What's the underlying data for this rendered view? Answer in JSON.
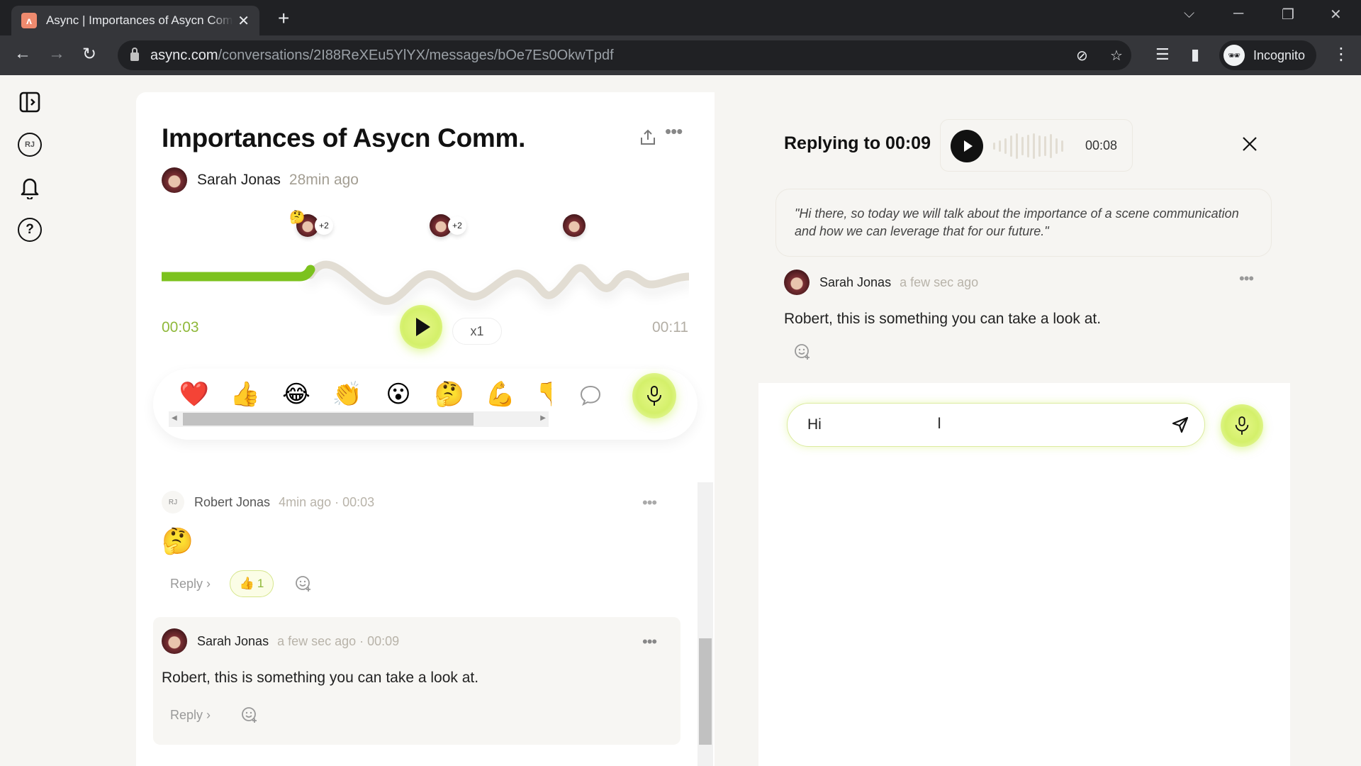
{
  "browser": {
    "tab_title": "Async | Importances of Asycn Comm.",
    "tab_close": "✕",
    "new_tab": "+",
    "url_host": "async.com",
    "url_path": "/conversations/2I88ReXEu5YlYX/messages/bOe7Es0OkwTpdf",
    "profile_label": "Incognito",
    "icons": [
      "back-icon",
      "forward-icon",
      "reload-icon",
      "lock-icon",
      "eye-off-icon",
      "star-icon",
      "media-icon",
      "sidepanel-icon",
      "incognito-icon",
      "menu-icon"
    ]
  },
  "rail": {
    "items": [
      {
        "name": "toggle-sidebar",
        "icon": "sidebar-expand-icon"
      },
      {
        "name": "profile",
        "label": "RJ"
      },
      {
        "name": "notifications",
        "icon": "bell-icon"
      },
      {
        "name": "help",
        "label": "?"
      }
    ]
  },
  "conversation": {
    "title": "Importances of Asycn Comm.",
    "author": "Sarah Jonas",
    "time_ago": "28min ago",
    "markers": [
      {
        "emoji": "🤔",
        "extra": "+2"
      },
      {
        "emoji": "",
        "extra": "+2"
      },
      {
        "emoji": "",
        "extra": ""
      }
    ],
    "player": {
      "current": "00:03",
      "total": "00:11",
      "speed": "x1",
      "progress": 0.27
    },
    "reactions": [
      "❤️",
      "👍",
      "😂",
      "👏",
      "😮",
      "🤔",
      "💪",
      "👎"
    ],
    "comments": [
      {
        "initials": "RJ",
        "author": "Robert Jonas",
        "meta": "4min ago · 00:03",
        "emoji": "🤔",
        "reply_label": "Reply ›",
        "reaction": {
          "emoji": "👍",
          "count": "1"
        }
      },
      {
        "author": "Sarah Jonas",
        "meta": "a few sec ago · 00:09",
        "text": "Robert, this is something you can take a look at.",
        "reply_label": "Reply ›"
      }
    ]
  },
  "reply_panel": {
    "title": "Replying to 00:09",
    "clip_duration": "00:08",
    "quote": "\"Hi there, so today we will talk about the importance of a scene communication and how we can leverage that for our future.\"",
    "comment": {
      "author": "Sarah Jonas",
      "time_ago": "a few sec ago",
      "text": "Robert, this is something you can take a look at."
    },
    "input_value": "Hi",
    "input_placeholder": ""
  },
  "colors": {
    "accent_green": "#8fb83a",
    "accent_lime": "#d4f06a",
    "progress_green": "#7cc21e",
    "wave_grey": "#e2ddd3"
  }
}
